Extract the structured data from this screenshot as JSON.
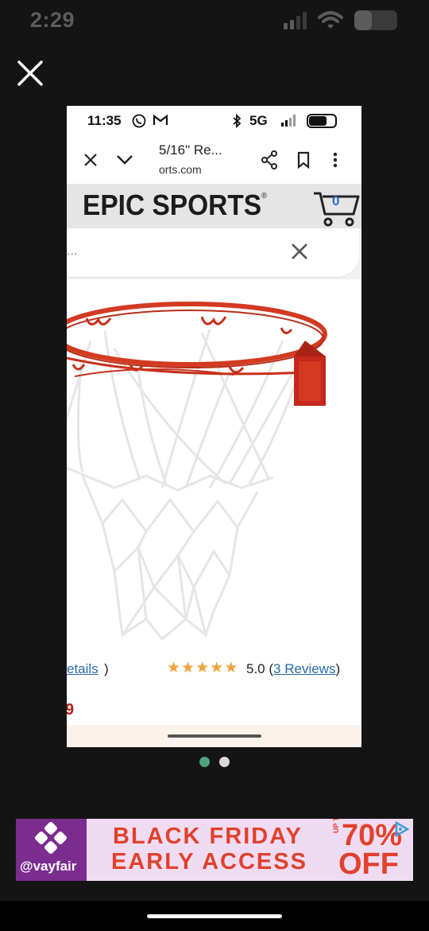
{
  "status_bar": {
    "time": "2:29"
  },
  "viewer": {
    "close_icon": "close-icon"
  },
  "inner_screenshot": {
    "status": {
      "time": "11:35",
      "network": "5G"
    },
    "browser": {
      "title": "5/16\" Re...",
      "domain": "orts.com"
    },
    "site": {
      "logo": "EPIC SPORTS",
      "logo_mark": "®",
      "cart_count": "0"
    },
    "search": {
      "placeholder": "..."
    },
    "product": {
      "details_link": "etails",
      "rating": "5.0",
      "reviews_link": "3 Reviews",
      "stars": 5,
      "price_fragment": "9"
    }
  },
  "pager": {
    "count": 2,
    "active": 0,
    "colors": {
      "active": "#4ea37c",
      "inactive": "#d9d9d9"
    }
  },
  "ad": {
    "brand": "@vayfair",
    "line1": "BLACK FRIDAY",
    "line2": "EARLY ACCESS",
    "up_to": "UP TO",
    "percent": "70%",
    "off": "OFF",
    "colors": {
      "background": "#efdcf3",
      "accent": "#e2412d",
      "logo_bg": "#7b2c8f"
    }
  }
}
